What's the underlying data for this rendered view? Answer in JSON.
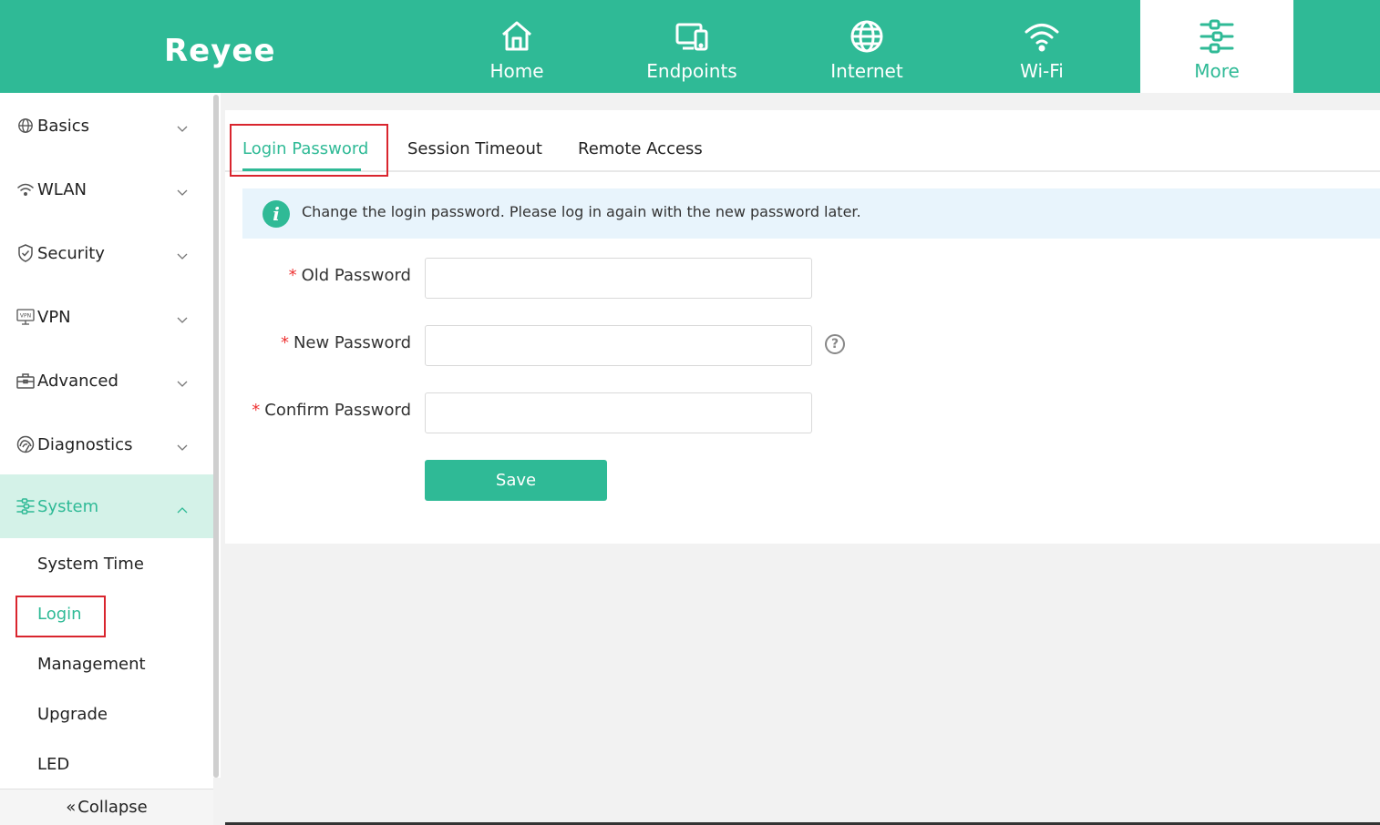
{
  "header": {
    "logo": "Reyee",
    "nav": [
      {
        "label": "Home",
        "icon": "home-icon"
      },
      {
        "label": "Endpoints",
        "icon": "devices-icon"
      },
      {
        "label": "Internet",
        "icon": "globe-icon"
      },
      {
        "label": "Wi-Fi",
        "icon": "wifi-icon"
      },
      {
        "label": "More",
        "icon": "settings-sliders-icon",
        "active": true
      }
    ]
  },
  "sidebar": {
    "items": [
      {
        "label": "Basics",
        "icon": "globe-icon"
      },
      {
        "label": "WLAN",
        "icon": "wifi-icon"
      },
      {
        "label": "Security",
        "icon": "shield-icon"
      },
      {
        "label": "VPN",
        "icon": "vpn-icon"
      },
      {
        "label": "Advanced",
        "icon": "toolbox-icon"
      },
      {
        "label": "Diagnostics",
        "icon": "diagnostics-icon"
      },
      {
        "label": "System",
        "icon": "system-sliders-icon",
        "expanded": true
      }
    ],
    "system_children": [
      "System Time",
      "Login",
      "Management",
      "Upgrade",
      "LED"
    ],
    "active_child": "Login",
    "collapse_label": "Collapse"
  },
  "main": {
    "tabs": [
      "Login Password",
      "Session Timeout",
      "Remote Access"
    ],
    "active_tab": "Login Password",
    "info_text": "Change the login password. Please log in again with the new password later.",
    "form": {
      "old_password_label": "Old Password",
      "new_password_label": "New Password",
      "confirm_password_label": "Confirm Password",
      "required_mark": "*",
      "save_label": "Save"
    }
  },
  "colors": {
    "brand": "#2fba96",
    "highlight_box": "#d9252e",
    "info_bg": "#e8f4fc"
  }
}
